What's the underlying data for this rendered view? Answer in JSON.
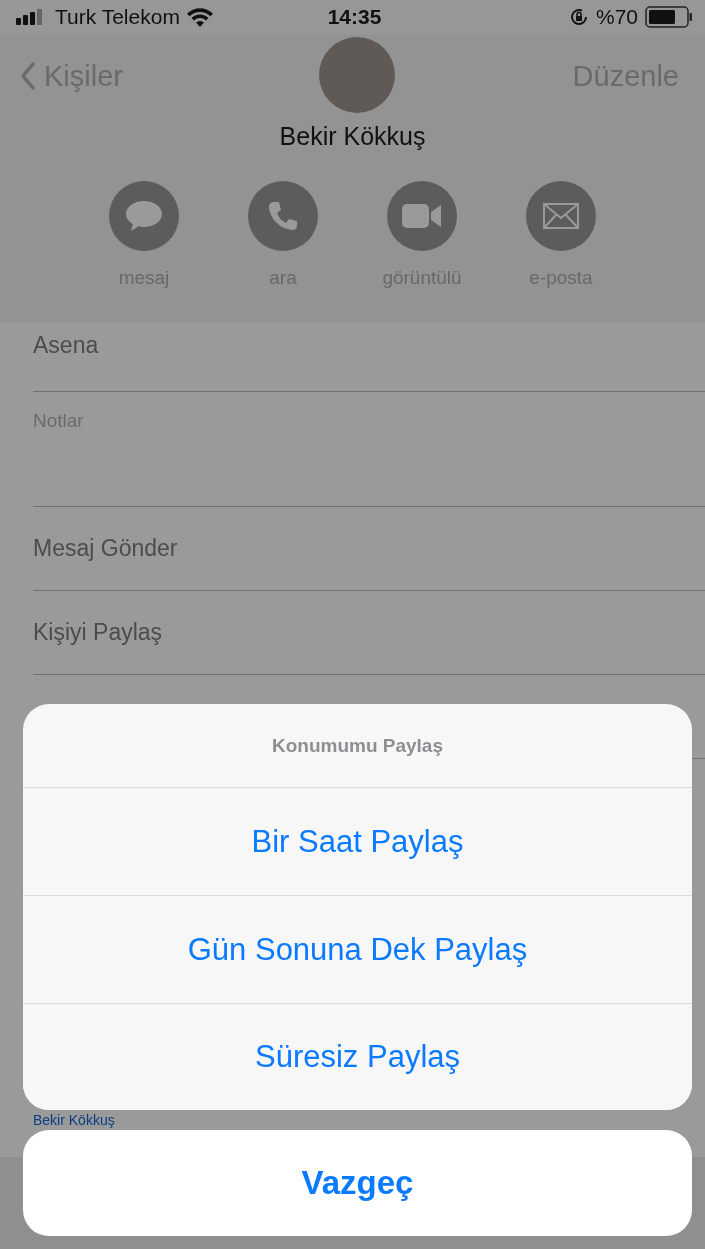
{
  "status_bar": {
    "carrier": "Turk Telekom",
    "time": "14:35",
    "battery": "%70"
  },
  "nav": {
    "back": "Kişiler",
    "edit": "Düzenle"
  },
  "contact": {
    "name": "Bekir Kökkuş"
  },
  "actions": [
    {
      "kind": "message",
      "label": "mesaj"
    },
    {
      "kind": "call",
      "label": "ara"
    },
    {
      "kind": "video",
      "label": "görüntülü"
    },
    {
      "kind": "mail",
      "label": "e-posta"
    }
  ],
  "rows": [
    {
      "kind": "value",
      "text": "Asena"
    },
    {
      "kind": "notes",
      "text": "Notlar"
    },
    {
      "kind": "action",
      "text": "Mesaj Gönder"
    },
    {
      "kind": "action",
      "text": "Kişiyi Paylaş"
    }
  ],
  "linked_contact": "Bekir Kökkuş",
  "action_sheet": {
    "title": "Konumumu Paylaş",
    "options": [
      "Bir Saat Paylaş",
      "Gün Sonuna Dek Paylaş",
      "Süresiz Paylaş"
    ],
    "cancel": "Vazgeç"
  }
}
